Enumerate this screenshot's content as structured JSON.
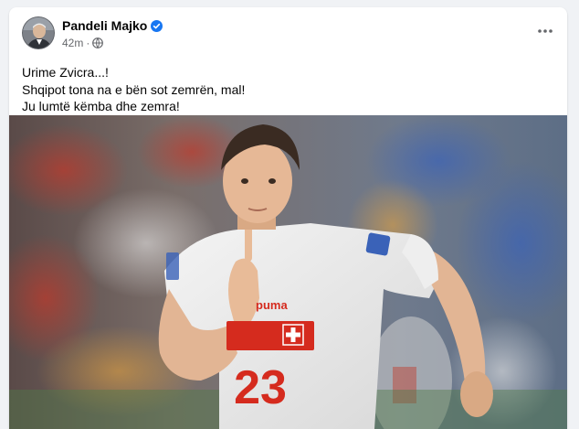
{
  "post": {
    "author": "Pandeli Majko",
    "timestamp": "42m",
    "audience_icon": "globe-icon",
    "verified_icon": "verified-badge-icon",
    "more_icon": "more-horizontal-icon",
    "lines": [
      "Urime Zvicra...!",
      "Shqipot tona na e bën sot zemrën, mal!",
      "Ju lumtë këmba dhe zemra!"
    ],
    "photo": {
      "jersey_brand": "puma",
      "jersey_number": "23"
    }
  },
  "colors": {
    "background": "#f0f2f5",
    "card": "#ffffff",
    "verified_blue": "#1877f2",
    "secondary_text": "#65676b",
    "jersey_red": "#d52b1e"
  }
}
